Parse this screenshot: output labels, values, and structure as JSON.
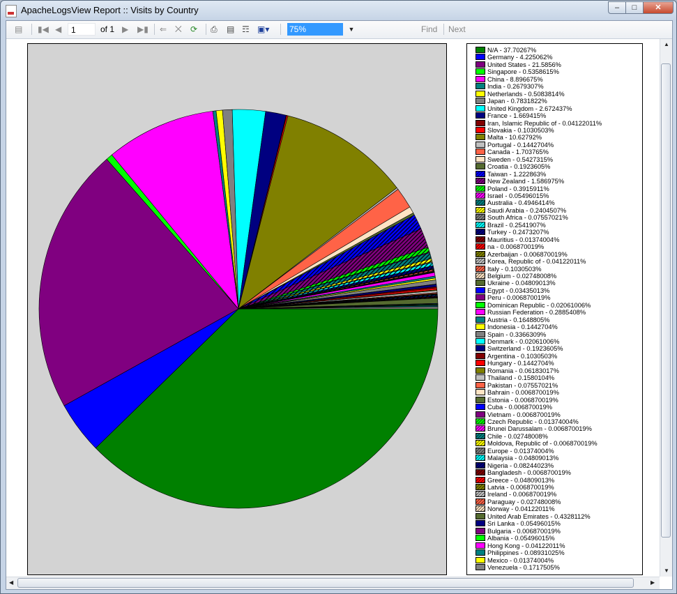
{
  "window": {
    "title": "ApacheLogsView Report :: Visits by Country"
  },
  "toolbar": {
    "page_current": "1",
    "page_of": "of 1",
    "zoom_value": "75%",
    "find_label": "Find",
    "next_label": "Next"
  },
  "chart_data": {
    "type": "pie",
    "title": "",
    "slices": [
      {
        "label": "N/A - 37.70267%",
        "value": 37.70267,
        "color": "#008000"
      },
      {
        "label": "Germany - 4.225062%",
        "value": 4.225062,
        "color": "#0000ff"
      },
      {
        "label": "United States - 21.5856%",
        "value": 21.5856,
        "color": "#800080"
      },
      {
        "label": "Singapore - 0.5358615%",
        "value": 0.5358615,
        "color": "#00ff00"
      },
      {
        "label": "China - 8.896675%",
        "value": 8.896675,
        "color": "#ff00ff"
      },
      {
        "label": "India - 0.2679307%",
        "value": 0.2679307,
        "color": "#008080"
      },
      {
        "label": "Netherlands - 0.5083814%",
        "value": 0.5083814,
        "color": "#ffff00"
      },
      {
        "label": "Japan - 0.7831822%",
        "value": 0.7831822,
        "color": "#808080"
      },
      {
        "label": "United Kingdom - 2.672437%",
        "value": 2.672437,
        "color": "#00ffff"
      },
      {
        "label": "France - 1.669415%",
        "value": 1.669415,
        "color": "#000080"
      },
      {
        "label": "Iran, Islamic Republic of - 0.04122011%",
        "value": 0.04122011,
        "color": "#800000"
      },
      {
        "label": "Slovakia - 0.1030503%",
        "value": 0.1030503,
        "color": "#ff0000"
      },
      {
        "label": "Malta - 10.62792%",
        "value": 10.62792,
        "color": "#808000"
      },
      {
        "label": "Portugal - 0.1442704%",
        "value": 0.1442704,
        "color": "#c0c0c0"
      },
      {
        "label": "Canada - 1.703765%",
        "value": 1.703765,
        "color": "#ff6347"
      },
      {
        "label": "Sweden - 0.5427315%",
        "value": 0.5427315,
        "color": "#ffe4c4"
      },
      {
        "label": "Croatia - 0.1923605%",
        "value": 0.1923605,
        "color": "#556b2f"
      },
      {
        "label": "Taiwan - 1.222863%",
        "value": 1.222863,
        "color": "#0000ff",
        "hatch": true
      },
      {
        "label": "New Zealand - 1.586975%",
        "value": 1.586975,
        "color": "#800080",
        "hatch": true
      },
      {
        "label": "Poland - 0.3915911%",
        "value": 0.3915911,
        "color": "#00ff00",
        "hatch": true
      },
      {
        "label": "Israel - 0.05496015%",
        "value": 0.05496015,
        "color": "#ff00ff",
        "hatch": true
      },
      {
        "label": "Australia - 0.4946414%",
        "value": 0.4946414,
        "color": "#008080",
        "hatch": true
      },
      {
        "label": "Saudi Arabia - 0.2404507%",
        "value": 0.2404507,
        "color": "#ffff00",
        "hatch": true
      },
      {
        "label": "South Africa - 0.07557021%",
        "value": 0.07557021,
        "color": "#808080",
        "hatch": true
      },
      {
        "label": "Brazil - 0.2541907%",
        "value": 0.2541907,
        "color": "#00ffff",
        "hatch": true
      },
      {
        "label": "Turkey - 0.2473207%",
        "value": 0.2473207,
        "color": "#000080",
        "hatch": true
      },
      {
        "label": "Mauritius - 0.01374004%",
        "value": 0.01374004,
        "color": "#800000",
        "hatch": true
      },
      {
        "label": "na - 0.006870019%",
        "value": 0.006870019,
        "color": "#ff0000",
        "hatch": true
      },
      {
        "label": "Azerbaijan - 0.006870019%",
        "value": 0.006870019,
        "color": "#808000",
        "hatch": true
      },
      {
        "label": "Korea, Republic of - 0.04122011%",
        "value": 0.04122011,
        "color": "#c0c0c0",
        "hatch": true
      },
      {
        "label": "Italy - 0.1030503%",
        "value": 0.1030503,
        "color": "#ff6347",
        "hatch": true
      },
      {
        "label": "Belgium - 0.02748008%",
        "value": 0.02748008,
        "color": "#ffe4c4",
        "hatch": true
      },
      {
        "label": "Ukraine - 0.04809013%",
        "value": 0.04809013,
        "color": "#556b2f"
      },
      {
        "label": "Egypt - 0.03435013%",
        "value": 0.03435013,
        "color": "#0000ff"
      },
      {
        "label": "Peru - 0.006870019%",
        "value": 0.006870019,
        "color": "#800080"
      },
      {
        "label": "Dominican Republic - 0.02061006%",
        "value": 0.02061006,
        "color": "#00ff00"
      },
      {
        "label": "Russian Federation - 0.2885408%",
        "value": 0.2885408,
        "color": "#ff00ff"
      },
      {
        "label": "Austria - 0.1648805%",
        "value": 0.1648805,
        "color": "#008080"
      },
      {
        "label": "Indonesia - 0.1442704%",
        "value": 0.1442704,
        "color": "#ffff00"
      },
      {
        "label": "Spain - 0.3366309%",
        "value": 0.3366309,
        "color": "#808080"
      },
      {
        "label": "Denmark - 0.02061006%",
        "value": 0.02061006,
        "color": "#00ffff"
      },
      {
        "label": "Switzerland - 0.1923605%",
        "value": 0.1923605,
        "color": "#000080"
      },
      {
        "label": "Argentina - 0.1030503%",
        "value": 0.1030503,
        "color": "#800000"
      },
      {
        "label": "Hungary - 0.1442704%",
        "value": 0.1442704,
        "color": "#ff0000"
      },
      {
        "label": "Romania - 0.06183017%",
        "value": 0.06183017,
        "color": "#808000"
      },
      {
        "label": "Thailand - 0.1580104%",
        "value": 0.1580104,
        "color": "#c0c0c0"
      },
      {
        "label": "Pakistan - 0.07557021%",
        "value": 0.07557021,
        "color": "#ff6347"
      },
      {
        "label": "Bahrain - 0.006870019%",
        "value": 0.006870019,
        "color": "#ffe4c4"
      },
      {
        "label": "Estonia - 0.006870019%",
        "value": 0.006870019,
        "color": "#556b2f"
      },
      {
        "label": "Cuba - 0.006870019%",
        "value": 0.006870019,
        "color": "#0000ff"
      },
      {
        "label": "Vietnam - 0.006870019%",
        "value": 0.006870019,
        "color": "#800080"
      },
      {
        "label": "Czech Republic - 0.01374004%",
        "value": 0.01374004,
        "color": "#00ff00",
        "hatch": true
      },
      {
        "label": "Brunei Darussalam - 0.006870019%",
        "value": 0.006870019,
        "color": "#ff00ff",
        "hatch": true
      },
      {
        "label": "Chile - 0.02748008%",
        "value": 0.02748008,
        "color": "#008080",
        "hatch": true
      },
      {
        "label": "Moldova, Republic of - 0.006870019%",
        "value": 0.006870019,
        "color": "#ffff00",
        "hatch": true
      },
      {
        "label": "Europe - 0.01374004%",
        "value": 0.01374004,
        "color": "#808080",
        "hatch": true
      },
      {
        "label": "Malaysia - 0.04809013%",
        "value": 0.04809013,
        "color": "#00ffff",
        "hatch": true
      },
      {
        "label": "Nigeria - 0.08244023%",
        "value": 0.08244023,
        "color": "#000080",
        "hatch": true
      },
      {
        "label": "Bangladesh - 0.006870019%",
        "value": 0.006870019,
        "color": "#800000",
        "hatch": true
      },
      {
        "label": "Greece - 0.04809013%",
        "value": 0.04809013,
        "color": "#ff0000",
        "hatch": true
      },
      {
        "label": "Latvia - 0.006870019%",
        "value": 0.006870019,
        "color": "#808000",
        "hatch": true
      },
      {
        "label": "Ireland - 0.006870019%",
        "value": 0.006870019,
        "color": "#c0c0c0",
        "hatch": true
      },
      {
        "label": "Paraguay - 0.02748008%",
        "value": 0.02748008,
        "color": "#ff6347",
        "hatch": true
      },
      {
        "label": "Norway - 0.04122011%",
        "value": 0.04122011,
        "color": "#ffe4c4",
        "hatch": true
      },
      {
        "label": "United Arab Emirates - 0.4328112%",
        "value": 0.4328112,
        "color": "#556b2f"
      },
      {
        "label": "Sri Lanka - 0.05496015%",
        "value": 0.05496015,
        "color": "#000080"
      },
      {
        "label": "Bulgaria - 0.006870019%",
        "value": 0.006870019,
        "color": "#800080"
      },
      {
        "label": "Albania - 0.05496015%",
        "value": 0.05496015,
        "color": "#00ff00"
      },
      {
        "label": "Hong Kong - 0.04122011%",
        "value": 0.04122011,
        "color": "#ff00ff"
      },
      {
        "label": "Philippines - 0.08931025%",
        "value": 0.08931025,
        "color": "#008080"
      },
      {
        "label": "Mexico - 0.01374004%",
        "value": 0.01374004,
        "color": "#ffff00"
      },
      {
        "label": "Venezuela - 0.1717505%",
        "value": 0.1717505,
        "color": "#808080"
      }
    ]
  }
}
